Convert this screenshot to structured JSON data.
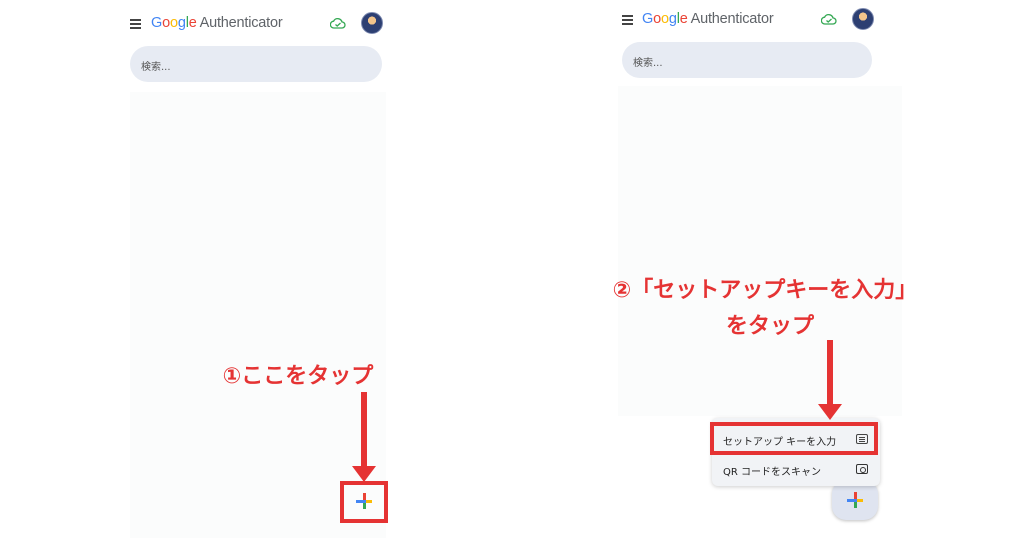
{
  "left_screen": {
    "app": {
      "logo_word": [
        "G",
        "o",
        "o",
        "g",
        "l",
        "e"
      ],
      "app_name": "Authenticator"
    },
    "search": {
      "placeholder": "検索..."
    },
    "icons": {
      "menu": "menu-icon",
      "cloud": "cloud-check-icon",
      "avatar": "user-avatar"
    }
  },
  "right_screen": {
    "app": {
      "logo_word": [
        "G",
        "o",
        "o",
        "g",
        "l",
        "e"
      ],
      "app_name": "Authenticator"
    },
    "search": {
      "placeholder": "検索..."
    },
    "menu": {
      "items": [
        {
          "label": "セットアップ キーを入力",
          "icon": "keyboard-icon"
        },
        {
          "label": "QR コードをスキャン",
          "icon": "camera-icon"
        }
      ]
    }
  },
  "annotations": {
    "step1": "①ここをタップ",
    "step2_line1": "②「セットアップキーを入力」",
    "step2_line2": "をタップ"
  },
  "colors": {
    "accent_red": "#e53333",
    "google_blue": "#4285F4",
    "google_red": "#EA4335",
    "google_yellow": "#FBBC05",
    "google_green": "#34A853",
    "search_bg": "#e7ebf3"
  }
}
